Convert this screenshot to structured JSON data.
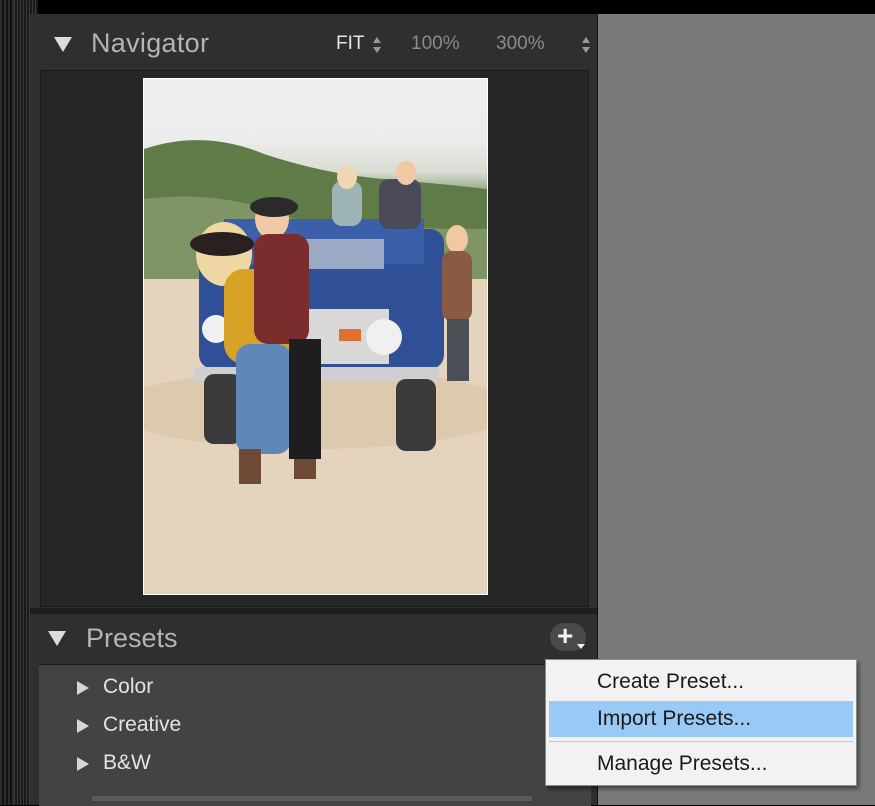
{
  "navigator": {
    "title": "Navigator",
    "zoom_fit": "FIT",
    "zoom_100": "100%",
    "zoom_300": "300%"
  },
  "presets": {
    "title": "Presets",
    "groups": [
      {
        "label": "Color"
      },
      {
        "label": "Creative"
      },
      {
        "label": "B&W"
      }
    ]
  },
  "context_menu": {
    "items": [
      {
        "label": "Create Preset..."
      },
      {
        "label": "Import Presets...",
        "highlighted": true
      },
      {
        "label": "Manage Presets..."
      }
    ]
  },
  "colors": {
    "panel_bg": "#2f2f2f",
    "canvas_bg": "#7a7a7a",
    "menu_highlight": "#99c9f5"
  }
}
